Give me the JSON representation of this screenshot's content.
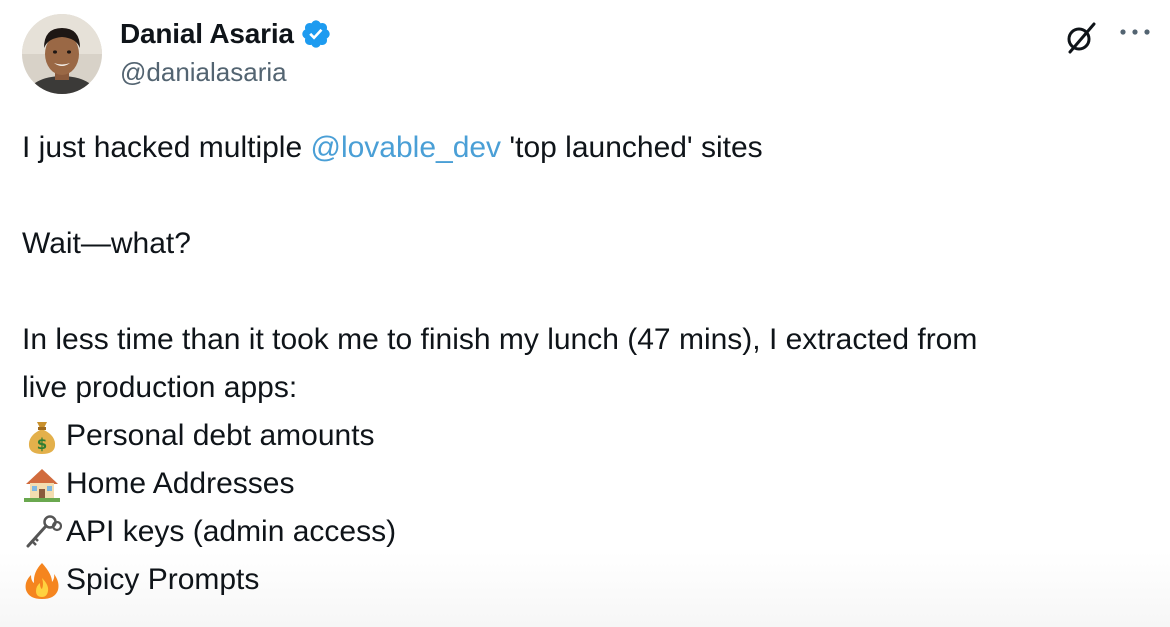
{
  "author": {
    "name": "Danial Asaria",
    "handle": "@danialasaria",
    "verified": true
  },
  "icons": {
    "verified": "verified-badge-icon",
    "grok": "grok-icon",
    "more": "more-options-icon"
  },
  "colors": {
    "mention": "#4a9fd6",
    "verified": "#1d9bf0",
    "handle": "#536471",
    "text": "#0f1419"
  },
  "post": {
    "line1_before": "I just hacked multiple ",
    "line1_mention": "@lovable_dev",
    "line1_after": " 'top launched' sites",
    "line2": "Wait—what?",
    "line3a": "In less time than it took me to finish my lunch (47 mins), I extracted from",
    "line3b": "live production apps:",
    "items": [
      {
        "icon": "money-bag-icon",
        "text": "Personal debt amounts"
      },
      {
        "icon": "house-icon",
        "text": "Home Addresses"
      },
      {
        "icon": "key-icon",
        "text": "API keys (admin access)"
      },
      {
        "icon": "fire-icon",
        "text": "Spicy Prompts"
      }
    ]
  }
}
